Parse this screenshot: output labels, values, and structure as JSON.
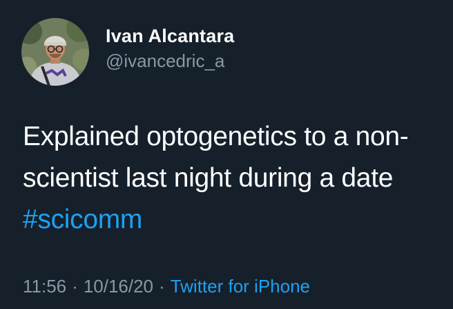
{
  "author": {
    "display_name": "Ivan Alcantara",
    "handle": "@ivancedric_a"
  },
  "tweet": {
    "lines": [
      "Explained optogenetics to a non-",
      "scientist last night during a date"
    ],
    "hashtag": "#scicomm"
  },
  "meta": {
    "time": "11:56",
    "separator": "·",
    "date": "10/16/20",
    "source": "Twitter for iPhone"
  },
  "colors": {
    "background": "#15202b",
    "text": "#ffffff",
    "secondary": "#8899a6",
    "link": "#1da1f2"
  },
  "icons": {
    "avatar": "profile-photo"
  }
}
